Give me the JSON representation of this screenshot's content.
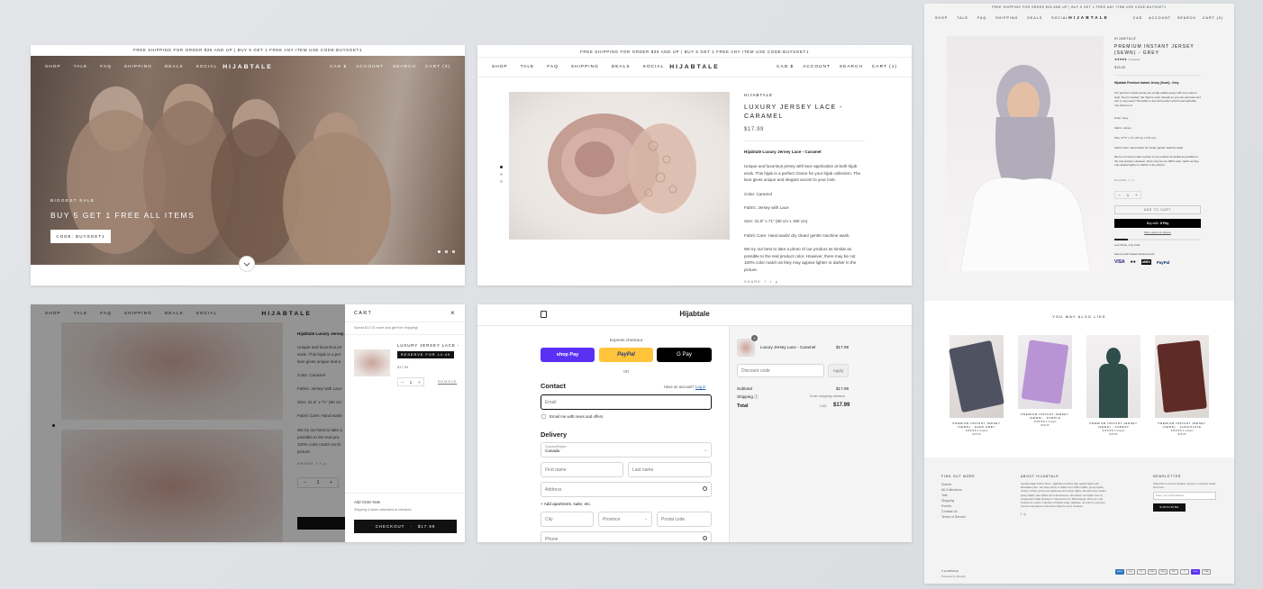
{
  "announcement": "FREE SHIPPING FOR ORDER $35 AND UP | BUY 5 GET 1 FREE ANY ITEM USE CODE:BUYSGET1",
  "brand": "HIJABTALE",
  "nav": {
    "left": [
      "SHOP",
      "TALE",
      "FAQ",
      "SHIPPING",
      "DEALS",
      "SOCIAL"
    ],
    "right": [
      "CAD $",
      "ACCOUNT",
      "SEARCH",
      "CART (1)"
    ],
    "right_home": [
      "CAD $",
      "ACCOUNT",
      "SEARCH",
      "CART (0)"
    ],
    "right_p3": [
      "CAD",
      "ACCOUNT",
      "SEARCH",
      "CART (0)"
    ]
  },
  "hero": {
    "kicker": "BIGGEST SALE",
    "headline": "BUY 5 GET 1 FREE ALL ITEMS",
    "cta": "CODE: BUYSGET1"
  },
  "product_lace": {
    "vendor": "HIJABTALE",
    "title": "LUXURY JERSEY LACE - CARAMEL",
    "price": "$17.99",
    "desc_title": "Hijabtale Luxury Jersey Lace - Caramel",
    "desc": "Unique and luxurious jersey with lace application at both hijab ends. This hijab is a perfect choice for your hijab collection. The lace gives unique and elegant accent to your look.",
    "color": "Color: Caramel",
    "fabric": "Fabric: Jersey with Lace",
    "size": "Size: 31.5\" x 71\" (80 cm x 180 cm)",
    "care": "Fabric Care: Hand wash/ dry clean/ gentle machine wash.",
    "note": "We try our best to take a photo of our product as similar as possible to the real product color. However, there may be not 100% color match as they may appear lighter or darker in the picture.",
    "share": "SHARE"
  },
  "product_grey": {
    "vendor": "HIJABTALE",
    "title": "PREMIUM INSTANT JERSEY (SEWN) - GREY",
    "reviews": "4 reviews",
    "price": "$15.00",
    "desc_title": "Hijabtale Premium Instant Jersey (Sewn) - Grey",
    "desc": "Our premium instant jersey are a high-quality jersey with very easy to style. No pin needed, the hijab is sewn already so you can just wear and turn it, very easy!! The fabric is airy with perfect stretch and adorably. You will love it!",
    "color": "Color: Grey",
    "fabric": "Fabric: Jersey",
    "size": "Size: 27.5\" x 71\" (70 cm x 175 cm)",
    "care": "Fabric Care: Hand wash/ dry clean/ gentle machine wash.",
    "note": "We try our best to take a photo of our product as similar as possible to the real product. However, there may be not 100% color match as they may appear lighter or darker in the picture.",
    "add_to_cart": "ADD TO CART",
    "buy_with": "Buy with",
    "gpay": "G Pay",
    "more_options": "More payment options",
    "low_stock": "Low Stock, only 3 left",
    "secure": "Secure and trusted checkout with",
    "pay_logos": [
      "VISA",
      "●●",
      "AMEX",
      "PayPal"
    ],
    "qty": "1"
  },
  "also_like": {
    "heading": "YOU MAY ALSO LIKE",
    "items": [
      {
        "name": "PREMIUM INSTANT JERSEY (SEWN) - DARK GREY",
        "reviews": "4 reviews",
        "price": "$15.00",
        "color": "#4e5261"
      },
      {
        "name": "PREMIUM INSTANT JERSEY (SEWN) - PURPLE",
        "reviews": "4 reviews",
        "price": "$15.00",
        "color": "#b994d4"
      },
      {
        "name": "PREMIUM INSTANT JERSEY (SEWN) - FOREST",
        "reviews": "6 reviews",
        "price": "$15.00",
        "color": "#2f4d4a"
      },
      {
        "name": "PREMIUM INSTANT JERSEY (SEWN) - CHOCOLATE",
        "reviews": "4 reviews",
        "price": "$15.00",
        "color": "#5e2b27"
      }
    ]
  },
  "footer": {
    "find_title": "FIND OUT MORE",
    "find_links": [
      "Search",
      "All Collections",
      "Tale",
      "Shipping",
      "Events",
      "Contact Us",
      "Terms of Service"
    ],
    "about_title": "ABOUT HIJABTALE",
    "about": "Canada Hijab Online Store - Hijabtale provides high quality hijabs with affordable price. We have plenty of hijabs from chiffon hijabs, jersey hijabs, instant, crinkle, jersey and pashmina and cotton hijabs. We also have instant jersey hijabs, lace hijabs and underscarves. We deliver our hijabs over by independent hijab boutique in Vancouver & in Mississauga. Shop our vast, timeless & modern collection of hijabs today. Hijabtale: we want to empower women everywhere to find their hijab for every occasion.",
    "news_title": "NEWSLETTER",
    "news_text": "Subscribe to receive updates, access to exclusive deals, and more.",
    "email_placeholder": "Enter your email address",
    "subscribe": "SUBSCRIBE",
    "copyright": "© HIJABTALE",
    "powered": "Powered by Shopify",
    "pay_icons": [
      "AMEX",
      "Pay",
      "DC",
      "DISC",
      "GPay",
      "MC",
      "P",
      "Shop",
      "VISA"
    ]
  },
  "cart": {
    "title": "CART",
    "free_ship": "Spend $17.01 more and get free shipping!",
    "item_title": "LUXURY JERSEY LACE - ...",
    "reserve": "RESERVE FOR 14:40",
    "item_price": "$17.99",
    "qty": "1",
    "remove": "REMOVE",
    "add_note": "Add Order Note",
    "taxes": "Shipping & taxes calculated at checkout",
    "checkout": "CHECKOUT",
    "checkout_total": "$17.99",
    "bg_desc_title": "Hijabtale Luxury Jersey L",
    "bg_lines": [
      "Unique and luxurious jer",
      "ends. This hijab is a per",
      "lace gives unique and e",
      "Color: Caramel",
      "Fabric: Jersey with Lace",
      "Size: 31.5\" x 71\" (80 cm",
      "Fabric Care: Hand wash",
      "We try our best to take a",
      "possible to the real pro",
      "100% color match as th",
      "picture."
    ],
    "bg_share": "SHARE",
    "bg_qty": "1"
  },
  "checkout": {
    "brand": "Hijabtale",
    "express": "Express checkout",
    "shop_pay": "shop Pay",
    "paypal": "PayPal",
    "gpay": "G Pay",
    "or": "OR",
    "contact": "Contact",
    "have_account": "Have an account?",
    "log_in": "Log in",
    "email_placeholder": "Email",
    "news_opt": "Email me with news and offers",
    "delivery": "Delivery",
    "country_label": "Country/Region",
    "country": "Canada",
    "first_name": "First name",
    "last_name": "Last name",
    "address": "Address",
    "add_apartment": "+ Add apartment, suite, etc.",
    "city": "City",
    "province": "Province",
    "postal": "Postal code",
    "phone": "Phone",
    "summary_item": "Luxury Jersey Lace - Caramel",
    "summary_qty": "1",
    "summary_price": "$17.99",
    "discount_placeholder": "Discount code",
    "apply": "Apply",
    "subtotal_label": "Subtotal",
    "subtotal": "$17.99",
    "shipping_label": "Shipping",
    "shipping": "Enter shipping address",
    "total_label": "Total",
    "currency": "CAD",
    "total": "$17.99"
  },
  "colors": {
    "accent": "#111111",
    "shop_pay": "#5a31f4",
    "paypal": "#ffc439",
    "blush": "#c9a39a"
  }
}
